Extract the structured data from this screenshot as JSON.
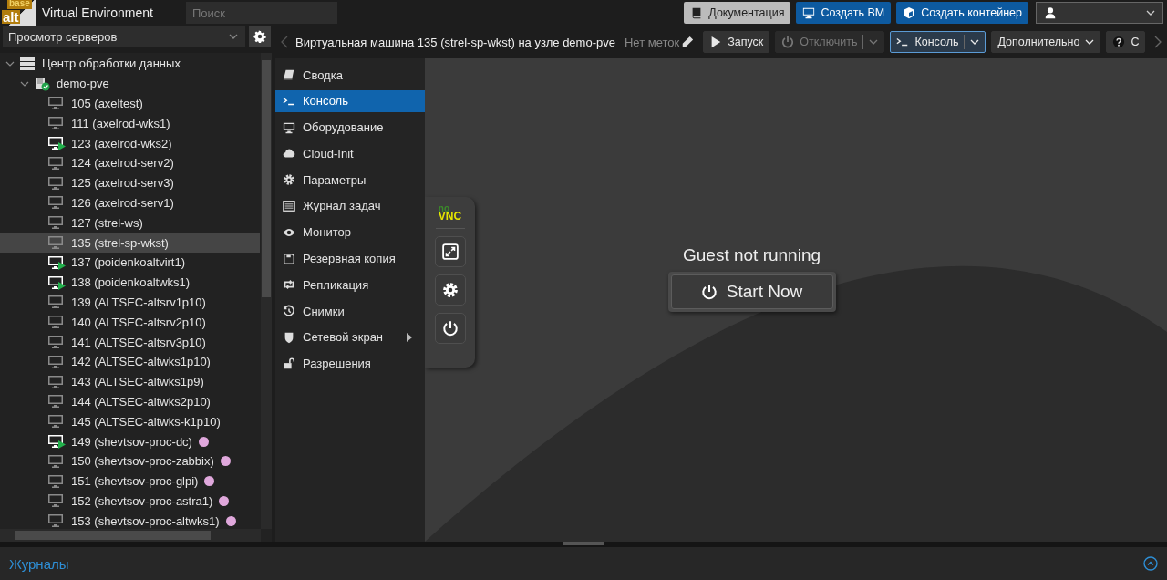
{
  "header": {
    "logo": {
      "top": "base",
      "bottom": "alt"
    },
    "title": "Virtual Environment",
    "search": {
      "placeholder": "Поиск"
    },
    "buttons": [
      {
        "label": "Документация",
        "kind": "docs"
      },
      {
        "label": "Создать ВМ",
        "kind": "vm"
      },
      {
        "label": "Создать контейнер",
        "kind": "container"
      }
    ]
  },
  "sidebar": {
    "view_select": {
      "value": "Просмотр серверов"
    },
    "tree": [
      {
        "label": "Центр обработки данных",
        "kind": "datacenter",
        "expanded": true,
        "selected": false,
        "children": [
          {
            "label": "demo-pve",
            "kind": "node",
            "expanded": true,
            "selected": false,
            "children": [
              {
                "label": "105 (axeltest)",
                "kind": "vm",
                "running": false,
                "selected": false
              },
              {
                "label": "111 (axelrod-wks1)",
                "kind": "vm",
                "running": false,
                "selected": false
              },
              {
                "label": "123 (axelrod-wks2)",
                "kind": "vm",
                "running": true,
                "selected": false
              },
              {
                "label": "124 (axelrod-serv2)",
                "kind": "vm",
                "running": false,
                "selected": false
              },
              {
                "label": "125 (axelrod-serv3)",
                "kind": "vm",
                "running": false,
                "selected": false
              },
              {
                "label": "126 (axelrod-serv1)",
                "kind": "vm",
                "running": false,
                "selected": false
              },
              {
                "label": "127 (strel-ws)",
                "kind": "vm",
                "running": false,
                "selected": false
              },
              {
                "label": "135 (strel-sp-wkst)",
                "kind": "vm",
                "running": false,
                "selected": true
              },
              {
                "label": "137 (poidenkoaltvirt1)",
                "kind": "vm",
                "running": true,
                "selected": false
              },
              {
                "label": "138 (poidenkoaltwks1)",
                "kind": "vm",
                "running": true,
                "selected": false
              },
              {
                "label": "139 (ALTSEC-altsrv1p10)",
                "kind": "vm",
                "running": false,
                "selected": false
              },
              {
                "label": "140 (ALTSEC-altsrv2p10)",
                "kind": "vm",
                "running": false,
                "selected": false
              },
              {
                "label": "141 (ALTSEC-altsrv3p10)",
                "kind": "vm",
                "running": false,
                "selected": false
              },
              {
                "label": "142 (ALTSEC-altwks1p10)",
                "kind": "vm",
                "running": false,
                "selected": false
              },
              {
                "label": "143 (ALTSEC-altwks1p9)",
                "kind": "vm",
                "running": false,
                "selected": false
              },
              {
                "label": "144 (ALTSEC-altwks2p10)",
                "kind": "vm",
                "running": false,
                "selected": false
              },
              {
                "label": "145 (ALTSEC-altwks-k1p10)",
                "kind": "vm",
                "running": false,
                "selected": false
              },
              {
                "label": "149 (shevtsov-proc-dc)",
                "kind": "vm",
                "running": true,
                "selected": false,
                "color": "#e0a8dc"
              },
              {
                "label": "150 (shevtsov-proc-zabbix)",
                "kind": "vm",
                "running": false,
                "selected": false,
                "color": "#e0a8dc"
              },
              {
                "label": "151 (shevtsov-proc-glpi)",
                "kind": "vm",
                "running": false,
                "selected": false,
                "color": "#e0a8dc"
              },
              {
                "label": "152 (shevtsov-proc-astra1)",
                "kind": "vm",
                "running": false,
                "selected": false,
                "color": "#e0a8dc"
              },
              {
                "label": "153 (shevtsov-proc-altwks1)",
                "kind": "vm",
                "running": false,
                "selected": false,
                "color": "#e0a8dc"
              }
            ]
          }
        ]
      }
    ]
  },
  "toolbar": {
    "title": "Виртуальная машина 135 (strel-sp-wkst) на узле demo-pve",
    "tags": "Нет меток",
    "buttons": [
      {
        "label": "Запуск",
        "kind": "start",
        "disabled": false,
        "focused": false
      },
      {
        "label": "Отключить",
        "kind": "shutdown",
        "disabled": true,
        "focused": false
      },
      {
        "label": "Консоль",
        "kind": "console",
        "disabled": false,
        "focused": true
      },
      {
        "label": "Дополнительно",
        "kind": "more",
        "disabled": false,
        "focused": false
      },
      {
        "label": "С",
        "kind": "help",
        "disabled": false,
        "focused": false
      }
    ]
  },
  "nav": [
    {
      "label": "Сводка",
      "kind": "book",
      "selected": false
    },
    {
      "label": "Консоль",
      "kind": "terminal",
      "selected": true
    },
    {
      "label": "Оборудование",
      "kind": "monitor",
      "selected": false
    },
    {
      "label": "Cloud-Init",
      "kind": "cloud",
      "selected": false
    },
    {
      "label": "Параметры",
      "kind": "gear",
      "selected": false
    },
    {
      "label": "Журнал задач",
      "kind": "list",
      "selected": false
    },
    {
      "label": "Монитор",
      "kind": "eye",
      "selected": false
    },
    {
      "label": "Резервная копия",
      "kind": "floppy",
      "selected": false
    },
    {
      "label": "Репликация",
      "kind": "retweet",
      "selected": false
    },
    {
      "label": "Снимки",
      "kind": "history",
      "selected": false
    },
    {
      "label": "Сетевой экран",
      "kind": "shield",
      "selected": false,
      "submenu": true
    },
    {
      "label": "Разрешения",
      "kind": "unlock",
      "selected": false
    }
  ],
  "console": {
    "novnc": {
      "logo_top": "no",
      "logo_bottom": "VNC"
    },
    "status": "Guest not running",
    "start_button": "Start Now"
  },
  "log_panel": {
    "title": "Журналы"
  }
}
